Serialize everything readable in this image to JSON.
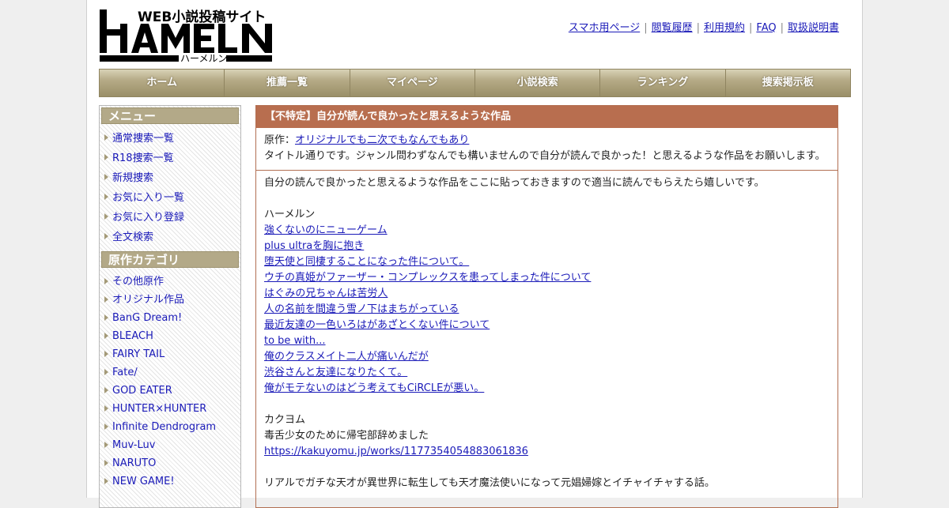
{
  "header": {
    "logo": {
      "tagline": "WEB小説投稿サイト",
      "name": "HAMELN",
      "kana": "ハーメルン"
    },
    "links": [
      "スマホ用ページ",
      "閲覧履歴",
      "利用規約",
      "FAQ",
      "取扱説明書"
    ]
  },
  "nav": [
    "ホーム",
    "推薦一覧",
    "マイページ",
    "小説検索",
    "ランキング",
    "捜索掲示板"
  ],
  "sidebar": {
    "menu_title": "メニュー",
    "menu_items": [
      "通常捜索一覧",
      "R18捜索一覧",
      "新規捜索",
      "お気に入り一覧",
      "お気に入り登録",
      "全文検索"
    ],
    "category_title": "原作カテゴリ",
    "categories": [
      "その他原作",
      "オリジナル作品",
      "BanG Dream!",
      "BLEACH",
      "FAIRY TAIL",
      "Fate/",
      "GOD EATER",
      "HUNTER×HUNTER",
      "Infinite Dendrogram",
      "Muv-Luv",
      "NARUTO",
      "NEW GAME!"
    ]
  },
  "main": {
    "title": "【不特定】自分が読んで良かったと思えるような作品",
    "source_label": "原作：",
    "source_link": "オリジナルでも二次でもなんでもあり",
    "summary": "タイトル通りです。ジャンル問わずなんでも構いませんので自分が読んで良かった！と思えるような作品をお願いします。",
    "intro": "自分の読んで良かったと思えるような作品をここに貼っておきますので適当に読んでもらえたら嬉しいです。",
    "section1_label": "ハーメルン",
    "hameln_works": [
      "強くないのにニューゲーム",
      "plus ultraを胸に抱き",
      "堕天使と同棲することになった件について。",
      "ウチの真姫がファーザー・コンプレックスを患ってしまった件について",
      "はぐみの兄ちゃんは苦労人",
      "人の名前を間違う雪ノ下はまちがっている",
      "最近友達の一色いろはがあざとくない件について",
      "to be with...",
      "俺のクラスメイト二人が痛いんだが",
      "渋谷さんと友達になりたくて。",
      "俺がモテないのはどう考えてもCiRCLEが悪い。"
    ],
    "section2_label": "カクヨム",
    "kakuyomu_title": "毒舌少女のために帰宅部辞めました",
    "kakuyomu_url": "https://kakuyomu.jp/works/1177354054883061836",
    "last_line": "リアルでガチな天才が異世界に転生しても天才魔法使いになって元娼婦嫁とイチャイチャする話。"
  }
}
